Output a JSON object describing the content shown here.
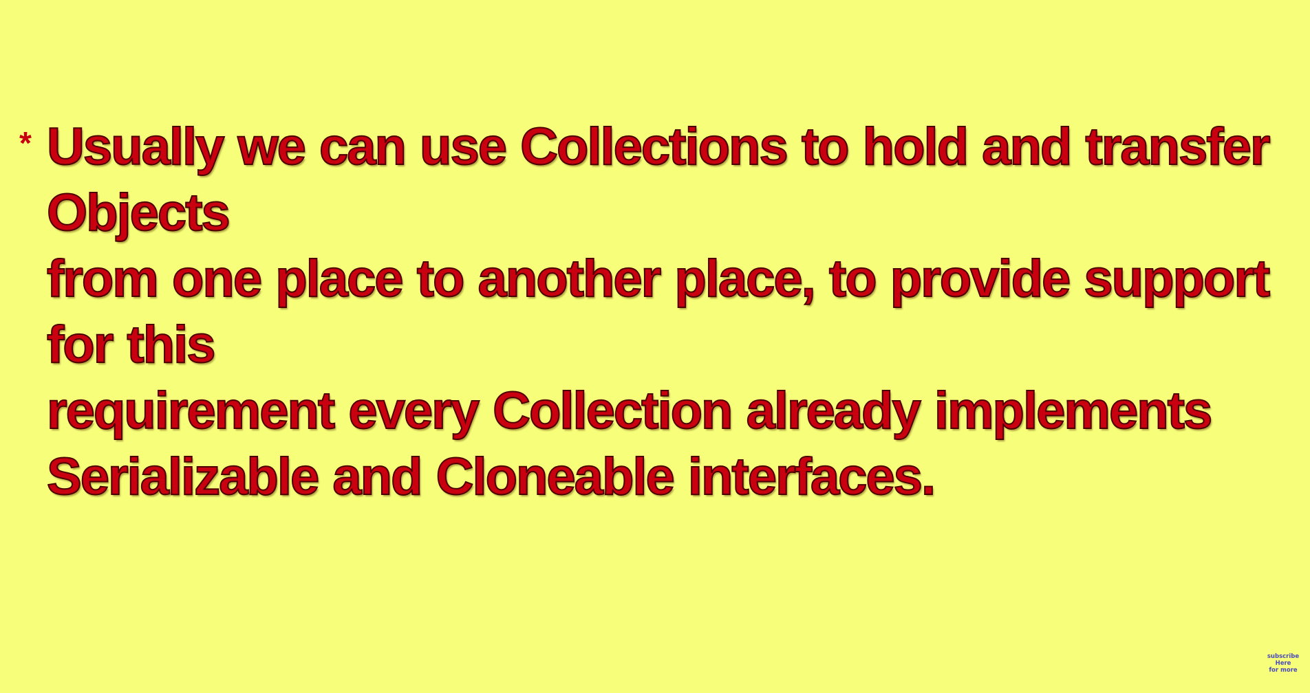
{
  "theme": {
    "background": "#f7fe7a",
    "text_color": "#c8000f",
    "bullet_color": "#c8000f",
    "badge_color": "#4a4ab8"
  },
  "slide": {
    "bullet_marker": "*",
    "lines": [
      "Usually we can use Collections to hold and transfer Objects",
      "from one place to another place, to provide support for this",
      "requirement every Collection already implements",
      "Serializable and Cloneable interfaces."
    ]
  },
  "subscribe_badge": {
    "line1": "subscribe",
    "line2": "Here",
    "line3": "for more"
  }
}
